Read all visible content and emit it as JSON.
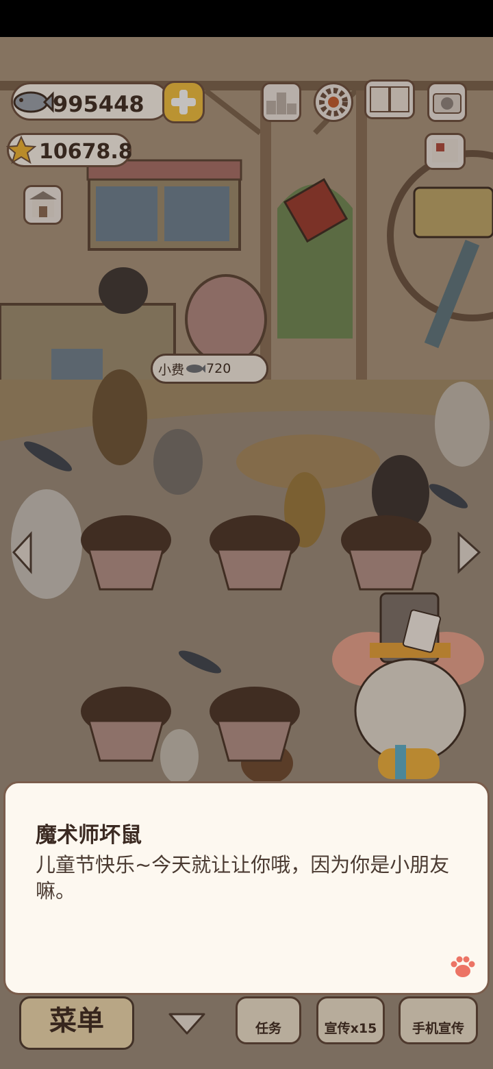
{
  "hud": {
    "fish_count": "995448",
    "star_count": "10678.8"
  },
  "scene": {
    "tip_label": "小费",
    "tip_amount": "720"
  },
  "bottom_bar": {
    "menu_label": "菜单",
    "tasks_label": "任务",
    "promote_label": "宣传x15",
    "phone_promote_label": "手机宣传"
  },
  "dialog": {
    "speaker": "魔术师坏鼠",
    "text": "儿童节快乐~今天就让让你哦，因为你是小朋友嘛。"
  },
  "colors": {
    "dialog_bg": "#fdf8f0",
    "dialog_border": "#7a5d4c",
    "hud_border": "#6b4e3d",
    "floor": "#9b8d7c"
  },
  "icons": [
    "fish-icon",
    "plus-icon",
    "star-icon",
    "ranking-icon",
    "gear-icon",
    "book-icon",
    "camera-icon",
    "shop-icon",
    "paw-icon",
    "left-arrow-icon",
    "right-arrow-icon",
    "down-arrow-icon"
  ]
}
